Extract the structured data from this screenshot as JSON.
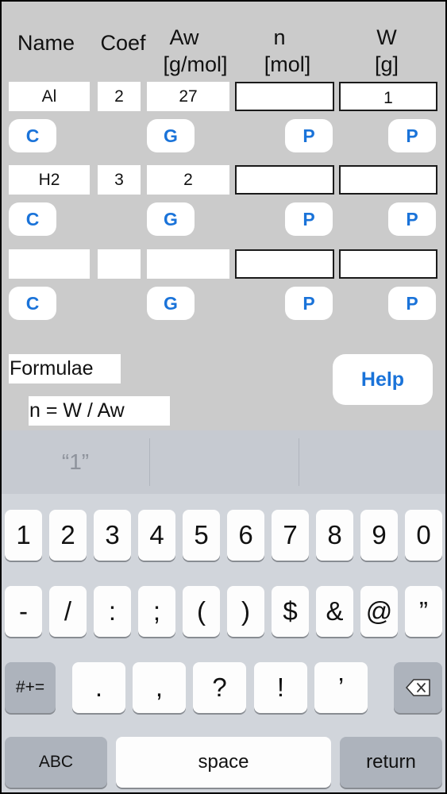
{
  "headers": {
    "name": "Name",
    "coef": "Coef",
    "aw": "Aw",
    "aw_unit": "[g/mol]",
    "n": "n",
    "n_unit": "[mol]",
    "w": "W",
    "w_unit": "[g]"
  },
  "rows": [
    {
      "name": "Al",
      "coef": "2",
      "aw": "27",
      "n": "",
      "w": "1",
      "btn_c": "C",
      "btn_g": "G",
      "btn_p_n": "P",
      "btn_p_w": "P"
    },
    {
      "name": "H2",
      "coef": "3",
      "aw": "2",
      "n": "",
      "w": "",
      "btn_c": "C",
      "btn_g": "G",
      "btn_p_n": "P",
      "btn_p_w": "P"
    },
    {
      "name": "",
      "coef": "",
      "aw": "",
      "n": "",
      "w": "",
      "btn_c": "C",
      "btn_g": "G",
      "btn_p_n": "P",
      "btn_p_w": "P"
    }
  ],
  "formulae_label": "Formulae",
  "formula": "n = W / Aw",
  "help_label": "Help",
  "keyboard": {
    "suggestions": [
      "“1”",
      "",
      ""
    ],
    "row1": [
      "1",
      "2",
      "3",
      "4",
      "5",
      "6",
      "7",
      "8",
      "9",
      "0"
    ],
    "row2": [
      "-",
      "/",
      ":",
      ";",
      "(",
      ")",
      "$",
      "&",
      "@",
      "”"
    ],
    "row3_left": "#+=",
    "row3_keys": [
      ".",
      ",",
      "?",
      "!",
      "’"
    ],
    "abc": "ABC",
    "space": "space",
    "return": "return"
  },
  "colors": {
    "background": "#cbcbcb",
    "accent": "#1a73d9"
  }
}
